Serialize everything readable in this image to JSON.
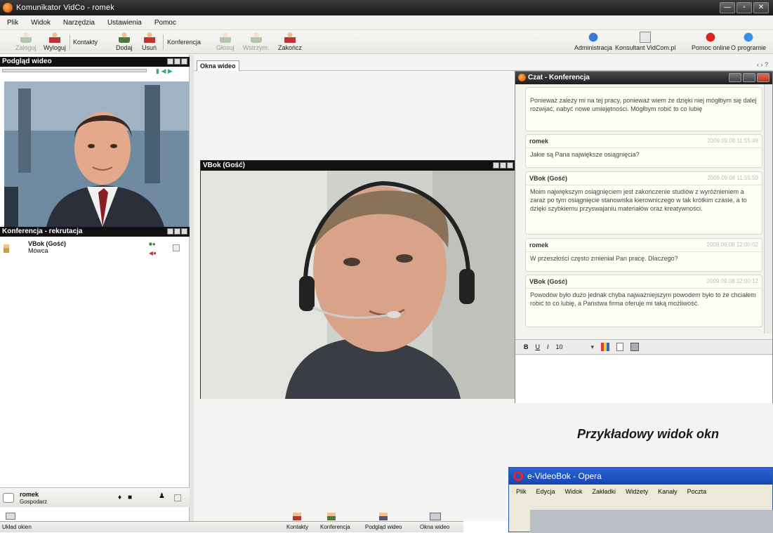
{
  "window": {
    "title": "Komunikator VidCo - romek",
    "controls": [
      "—",
      "▫",
      "✕"
    ]
  },
  "menu": [
    "Plik",
    "Widok",
    "Narzędzia",
    "Ustawienia",
    "Pomoc"
  ],
  "toolbar_left": {
    "zaloguj": "Zaloguj",
    "wyloguj": "Wyloguj",
    "kontakty": "Kontakty",
    "dodaj": "Dodaj",
    "usun": "Usuń",
    "konferencja": "Konferencja",
    "glosuj": "Głosuj",
    "wstrzymaj": "Wstrzym.",
    "zakoncz": "Zakończ"
  },
  "toolbar_right": {
    "administracja": "Administracja",
    "konsultant": "Konsultant VidCom.pl",
    "pomoc_online": "Pomoc online",
    "o_programie": "O programie"
  },
  "preview": {
    "title": "Podgląd wideo"
  },
  "conference": {
    "title": "Konferencja - rekrutacja",
    "participant_name": "VBok (Gość)",
    "participant_status": "Mówca"
  },
  "host": {
    "name": "romek",
    "role": "Gospodarz"
  },
  "tabs": {
    "video_windows": "Okna wideo",
    "nav": "‹ › ?"
  },
  "video_window": {
    "title": "VBok (Gość)"
  },
  "chat": {
    "title": "Czat - Konferencja",
    "messages": [
      {
        "author": "",
        "time": "",
        "text": "Ponieważ zależy mi na tej pracy, ponieważ wiem że dzięki niej mógłbym się dalej rozwijać, nabyć nowe umiejętności. Mógłbym robić to co lubię"
      },
      {
        "author": "romek",
        "time": "2009.09.08 11:55:49",
        "text": "Jakie są Pana największe osiągnięcia?"
      },
      {
        "author": "VBok (Gość)",
        "time": "2009.09.08 11:55:59",
        "text": "Moim największym osiągnięciem jest zakończenie studiów z wyróżnieniem a zaraz po tym osiągnięcie stanowiska kierowniczego w tak krótkim czasie, a to dzięki szybkiemu przyswajaniu materiałów oraz kreatywności."
      },
      {
        "author": "romek",
        "time": "2009.09.08 12:00:02",
        "text": "W przeszłości często zmieniał Pan pracę. Dlaczego?"
      },
      {
        "author": "VBok (Gość)",
        "time": "2009.09.08 12:00:12",
        "text": "Powodów było dużo jednak chyba najważniejszym powodem było to że chciałem robić to co lubię, a Państwa firma oferuje mi taką możliwość."
      }
    ],
    "format": {
      "bold": "B",
      "underline": "U",
      "italic": "I",
      "size": "10"
    }
  },
  "bottom_bar": {
    "layout": "Układ okien",
    "kontakty": "Kontakty",
    "konferencja": "Konferencja",
    "podglad": "Podgląd wideo",
    "okna": "Okna wideo"
  },
  "caption": "Przykładowy widok okn",
  "opera": {
    "title": "e-VideoBok - Opera",
    "menu": [
      "Plik",
      "Edycja",
      "Widok",
      "Zakładki",
      "Widżety",
      "Kanały",
      "Poczta"
    ]
  }
}
